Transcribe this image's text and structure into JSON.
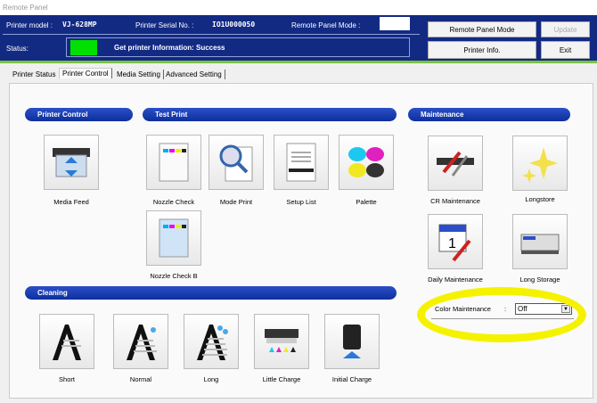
{
  "window": {
    "title": "Remote Panel"
  },
  "header": {
    "model_label": "Printer model :",
    "model": "VJ-628MP",
    "serial_label": "Printer Serial No. :",
    "serial": "IO1U000050",
    "mode_label": "Remote Panel Mode :",
    "status_label": "Status:",
    "status_color": "#00e000",
    "status_text": "Get printer Information: Success"
  },
  "buttons": {
    "remote_panel_mode": "Remote Panel Mode",
    "update": "Update",
    "printer_info": "Printer Info.",
    "exit": "Exit"
  },
  "tabs": [
    "Printer Status",
    "Printer Control",
    "Media Setting",
    "Advanced Setting"
  ],
  "active_tab": "Printer Control",
  "sections": {
    "printer_control": {
      "title": "Printer Control",
      "items": [
        "Media Feed"
      ]
    },
    "test_print": {
      "title": "Test Print",
      "items": [
        "Nozzle Check",
        "Mode Print",
        "Setup List",
        "Palette",
        "Nozzle Check  B"
      ]
    },
    "maintenance": {
      "title": "Maintenance",
      "items": [
        "CR Maintenance",
        "Longstore",
        "Daily Maintenance",
        "Long Storage"
      ],
      "color_maintenance_label": "Color Maintenance",
      "colon": ":",
      "color_maintenance_value": "Off"
    },
    "cleaning": {
      "title": "Cleaning",
      "items": [
        "Short",
        "Normal",
        "Long",
        "Little Charge",
        "Initial Charge"
      ]
    }
  },
  "highlight_color": "#f5f200"
}
